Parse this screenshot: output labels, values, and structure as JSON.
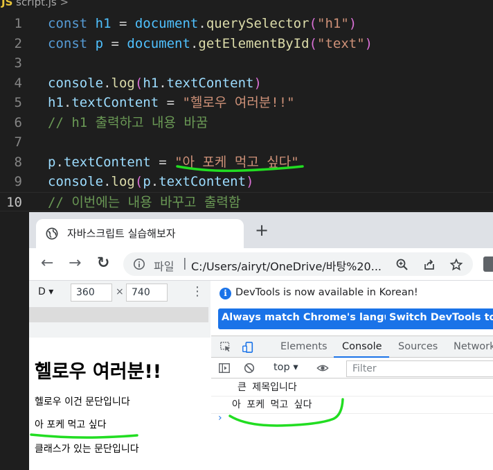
{
  "editor": {
    "tab": {
      "lang_badge": "JS",
      "filename": "script.js",
      "breadcrumb_sep": ">"
    },
    "lines": [
      {
        "n": "1",
        "tokens": [
          [
            "kw",
            "const "
          ],
          [
            "var",
            "h1"
          ],
          [
            "pl",
            " = "
          ],
          [
            "var",
            "document"
          ],
          [
            "pl",
            "."
          ],
          [
            "fn",
            "querySelector"
          ],
          [
            "pp",
            "("
          ],
          [
            "str",
            "\"h1\""
          ],
          [
            "pp",
            ")"
          ]
        ]
      },
      {
        "n": "2",
        "tokens": [
          [
            "kw",
            "const "
          ],
          [
            "var",
            "p"
          ],
          [
            "pl",
            " = "
          ],
          [
            "var",
            "document"
          ],
          [
            "pl",
            "."
          ],
          [
            "fn",
            "getElementById"
          ],
          [
            "pp",
            "("
          ],
          [
            "str",
            "\"text\""
          ],
          [
            "pp",
            ")"
          ]
        ]
      },
      {
        "n": "3",
        "tokens": []
      },
      {
        "n": "4",
        "tokens": [
          [
            "prop",
            "console"
          ],
          [
            "pl",
            "."
          ],
          [
            "fn",
            "log"
          ],
          [
            "pp",
            "("
          ],
          [
            "prop",
            "h1"
          ],
          [
            "pl",
            "."
          ],
          [
            "prop",
            "textContent"
          ],
          [
            "pp",
            ")"
          ]
        ]
      },
      {
        "n": "5",
        "tokens": [
          [
            "prop",
            "h1"
          ],
          [
            "pl",
            "."
          ],
          [
            "prop",
            "textContent"
          ],
          [
            "pl",
            " = "
          ],
          [
            "str",
            "\"헬로우 여러분!!\""
          ]
        ]
      },
      {
        "n": "6",
        "tokens": [
          [
            "cmt",
            "// h1 출력하고 내용 바꿈"
          ]
        ]
      },
      {
        "n": "7",
        "tokens": []
      },
      {
        "n": "8",
        "tokens": [
          [
            "prop",
            "p"
          ],
          [
            "pl",
            "."
          ],
          [
            "prop",
            "textContent"
          ],
          [
            "pl",
            " = "
          ],
          [
            "str",
            "\"아 포케 먹고 싶다\""
          ]
        ]
      },
      {
        "n": "9",
        "tokens": [
          [
            "prop",
            "console"
          ],
          [
            "pl",
            "."
          ],
          [
            "fn",
            "log"
          ],
          [
            "pp",
            "("
          ],
          [
            "prop",
            "p"
          ],
          [
            "pl",
            "."
          ],
          [
            "prop",
            "textContent"
          ],
          [
            "pp",
            ")"
          ]
        ]
      },
      {
        "n": "10",
        "tokens": [
          [
            "cmt",
            "// 이번에는 내용 바꾸고 출력함"
          ]
        ]
      }
    ]
  },
  "browser": {
    "tab_title": "자바스크립트 실습해보자",
    "new_tab_glyph": "+",
    "back_glyph": "←",
    "forward_glyph": "→",
    "reload_glyph": "↻",
    "url_scheme_label": "파일",
    "url_separator": "|",
    "url": "C:/Users/airyt/OneDrive/바탕%20...",
    "icons": [
      "globe-icon",
      "info-icon",
      "zoom-icon",
      "share-icon",
      "star-icon",
      "extension-icon"
    ]
  },
  "device_toolbar": {
    "device_label": "D ▾",
    "width": "360",
    "times": "×",
    "height": "740",
    "menu_glyph": "⋮"
  },
  "page": {
    "heading": "헬로우 여러분!!",
    "paragraphs": [
      "헬로우 이건 문단입니다",
      "아 포케 먹고 싶다",
      "클래스가 있는 문단입니다"
    ]
  },
  "devtools": {
    "info_glyph": "i",
    "infobar_text": "DevTools is now available in Korean!",
    "buttons": [
      "Always match Chrome's language",
      "Switch DevTools to Ko"
    ],
    "tabs": [
      "Elements",
      "Console",
      "Sources",
      "Network"
    ],
    "active_tab": "Console",
    "console_context": "top ▾",
    "filter_placeholder": "Filter",
    "logs": [
      "큰 제목입니다",
      "아 포케 먹고 싶다"
    ],
    "prompt_glyph": "›"
  },
  "colors": {
    "editor_bg": "#1e1e1e",
    "keyword": "#569cd6",
    "string": "#ce9178",
    "comment": "#6a9955",
    "chrome_blue": "#1a73e8",
    "highlight_green": "#22dd22"
  }
}
